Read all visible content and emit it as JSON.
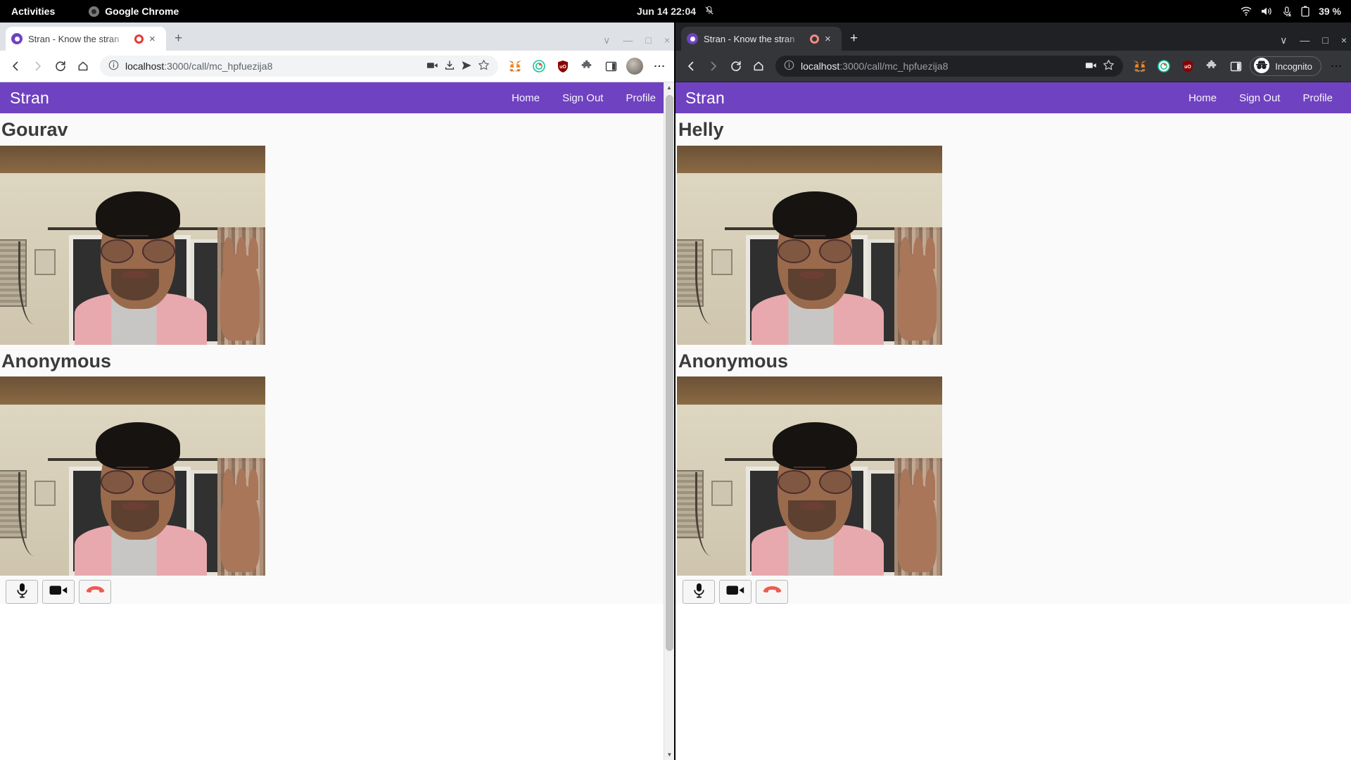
{
  "system_bar": {
    "activities": "Activities",
    "app_name": "Google Chrome",
    "clock": "Jun 14  22:04",
    "battery": "39 %",
    "icons": [
      "notification-bell-muted-icon",
      "wifi-icon",
      "volume-icon",
      "microphone-muted-icon",
      "battery-icon"
    ]
  },
  "windows": [
    {
      "id": "left",
      "mode": "light",
      "tab": {
        "title": "Stran - Know the stran",
        "favicon": "stran-favicon",
        "recording": "recording-indicator",
        "close": "×"
      },
      "new_tab": "+",
      "window_controls": {
        "tab_search": "∨",
        "minimize": "—",
        "maximize": "□",
        "close": "×"
      },
      "omnibox": {
        "host": "localhost",
        "path": ":3000/call/mc_hpfuezija8",
        "full_url": "localhost:3000/call/mc_hpfuezija8",
        "site_info": "info-icon"
      },
      "toolbar_icons": [
        "back-icon",
        "forward-icon",
        "reload-icon",
        "home-icon"
      ],
      "omnibox_icons": [
        "media-cast-icon",
        "install-app-icon",
        "share-icon",
        "bookmark-star-icon"
      ],
      "extension_icons": [
        "metamask-icon",
        "grammarly-icon",
        "ublock-origin-icon",
        "extensions-puzzle-icon",
        "side-panel-icon",
        "profile-avatar",
        "chrome-menu-icon"
      ],
      "page": {
        "brand": "Stran",
        "nav": [
          "Home",
          "Sign Out",
          "Profile"
        ],
        "peers": [
          {
            "name": "Gourav",
            "video": "remote-video-feed"
          },
          {
            "name": "Anonymous",
            "video": "local-video-feed"
          }
        ],
        "controls": [
          {
            "name": "microphone-toggle-button",
            "icon": "microphone-icon"
          },
          {
            "name": "camera-toggle-button",
            "icon": "video-camera-icon"
          },
          {
            "name": "end-call-button",
            "icon": "hangup-phone-icon"
          }
        ]
      }
    },
    {
      "id": "right",
      "mode": "dark",
      "tab": {
        "title": "Stran - Know the stran",
        "favicon": "stran-favicon",
        "recording": "recording-indicator",
        "close": "×"
      },
      "new_tab": "+",
      "window_controls": {
        "tab_search": "∨",
        "minimize": "—",
        "maximize": "□",
        "close": "×"
      },
      "omnibox": {
        "host": "localhost",
        "path": ":3000/call/mc_hpfuezija8",
        "full_url": "localhost:3000/call/mc_hpfuezija8",
        "site_info": "info-icon"
      },
      "toolbar_icons": [
        "back-icon",
        "forward-icon",
        "reload-icon",
        "home-icon"
      ],
      "omnibox_icons": [
        "media-cast-icon",
        "bookmark-star-icon"
      ],
      "extension_icons": [
        "metamask-icon",
        "grammarly-icon",
        "ublock-origin-icon",
        "extensions-puzzle-icon",
        "side-panel-icon",
        "chrome-menu-icon"
      ],
      "incognito_label": "Incognito",
      "page": {
        "brand": "Stran",
        "nav": [
          "Home",
          "Sign Out",
          "Profile"
        ],
        "peers": [
          {
            "name": "Helly",
            "video": "remote-video-feed"
          },
          {
            "name": "Anonymous",
            "video": "local-video-feed"
          }
        ],
        "controls": [
          {
            "name": "microphone-toggle-button",
            "icon": "microphone-icon"
          },
          {
            "name": "camera-toggle-button",
            "icon": "video-camera-icon"
          },
          {
            "name": "end-call-button",
            "icon": "hangup-phone-icon"
          }
        ]
      }
    }
  ],
  "colors": {
    "navbar_purple": "#6f42c1",
    "hangup_red": "#f05a4f",
    "recording_red": "#e53935",
    "page_bg": "#fafafa"
  }
}
